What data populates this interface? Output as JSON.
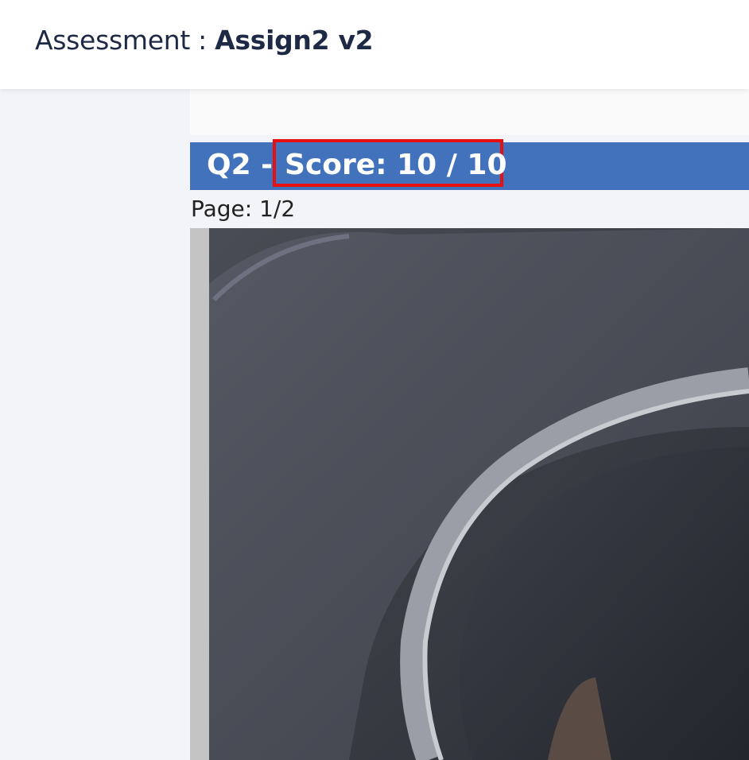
{
  "header": {
    "prefix": "Assessment : ",
    "assessment_name": "Assign2 v2"
  },
  "question": {
    "label": "Q2 - ",
    "score_text": "Score: 10 / 10"
  },
  "page_indicator": "Page: 1/2",
  "image": {
    "description_icon": "submission-photo"
  },
  "colors": {
    "header_bar": "#4272bb",
    "highlight_border": "#e61010",
    "title_text": "#1e2a45",
    "background": "#f3f4f8"
  }
}
